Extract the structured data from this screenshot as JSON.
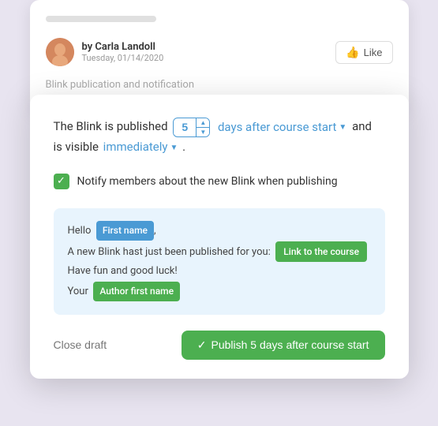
{
  "background": {
    "top_bar": "",
    "author": {
      "name": "by Carla Landoll",
      "date": "Tuesday, 01/14/2020"
    },
    "like_button": "Like",
    "blink_label": "Blink publication and notification"
  },
  "modal": {
    "sentence_part1": "The Blink is published",
    "days_value": "5",
    "days_after_label": "days after course start",
    "connector": "and",
    "visible_label": "is visible",
    "immediately_label": "immediately",
    "period": ".",
    "notify_checkbox": true,
    "notify_text": "Notify members about the new Blink when publishing"
  },
  "email_preview": {
    "hello": "Hello",
    "first_name_tag": "First name",
    "comma": ",",
    "line2": "A new Blink hast just been published for you:",
    "link_tag": "Link to the course",
    "line3": "Have fun and good luck!",
    "line4": "Your",
    "author_tag": "Author first name"
  },
  "footer": {
    "close_label": "Close draft",
    "publish_label": "Publish 5 days after course start"
  }
}
